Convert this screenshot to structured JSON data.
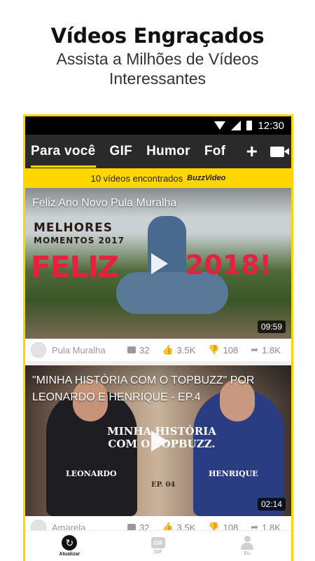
{
  "promo": {
    "title": "Vídeos Engraçados",
    "subtitle": "Assista a Milhões de Vídeos Interessantes"
  },
  "status_bar": {
    "time": "12:30"
  },
  "nav": {
    "tabs": [
      {
        "label": "Para você",
        "active": true
      },
      {
        "label": "GIF",
        "active": false
      },
      {
        "label": "Humor",
        "active": false
      },
      {
        "label": "Fof",
        "active": false
      }
    ],
    "plus_label": "+"
  },
  "found_bar": {
    "text": "10 vídeos encontrados",
    "brand": "BuzzVideo"
  },
  "videos": [
    {
      "title": "Feliz Ano Novo Pula Muralha",
      "duration": "09:59",
      "overlay": {
        "line1": "MELHORES",
        "line2": "MOMENTOS 2017",
        "feliz": "FELIZ",
        "year": "2018!"
      },
      "author": "Pula Muralha",
      "comments": "32",
      "likes": "3.5K",
      "dislikes": "108",
      "shares": "1.8K"
    },
    {
      "title": "\"MINHA HISTÓRIA COM O TOPBUZZ\" POR LEONARDO E HENRIQUE - EP.4",
      "duration": "02:14",
      "overlay": {
        "main": "MINHA HISTÓRIA COM O TOPBUZZ.",
        "left_name": "LEONARDO",
        "right_name": "HENRIQUE",
        "ep": "EP. 04"
      },
      "author": "Amarela",
      "comments": "32",
      "likes": "3.5K",
      "dislikes": "108",
      "shares": "1.8K"
    }
  ],
  "bottom_nav": {
    "items": [
      {
        "label": "Atualizar",
        "icon": "refresh-icon",
        "active": true
      },
      {
        "label": "GIF",
        "icon": "gif-icon",
        "active": false
      },
      {
        "label": "Eu",
        "icon": "user-icon",
        "active": false
      }
    ]
  },
  "colors": {
    "accent": "#ffd600",
    "nav_bg": "#2a2a2a",
    "status_bg": "#000000",
    "title_red": "#e4213e"
  }
}
